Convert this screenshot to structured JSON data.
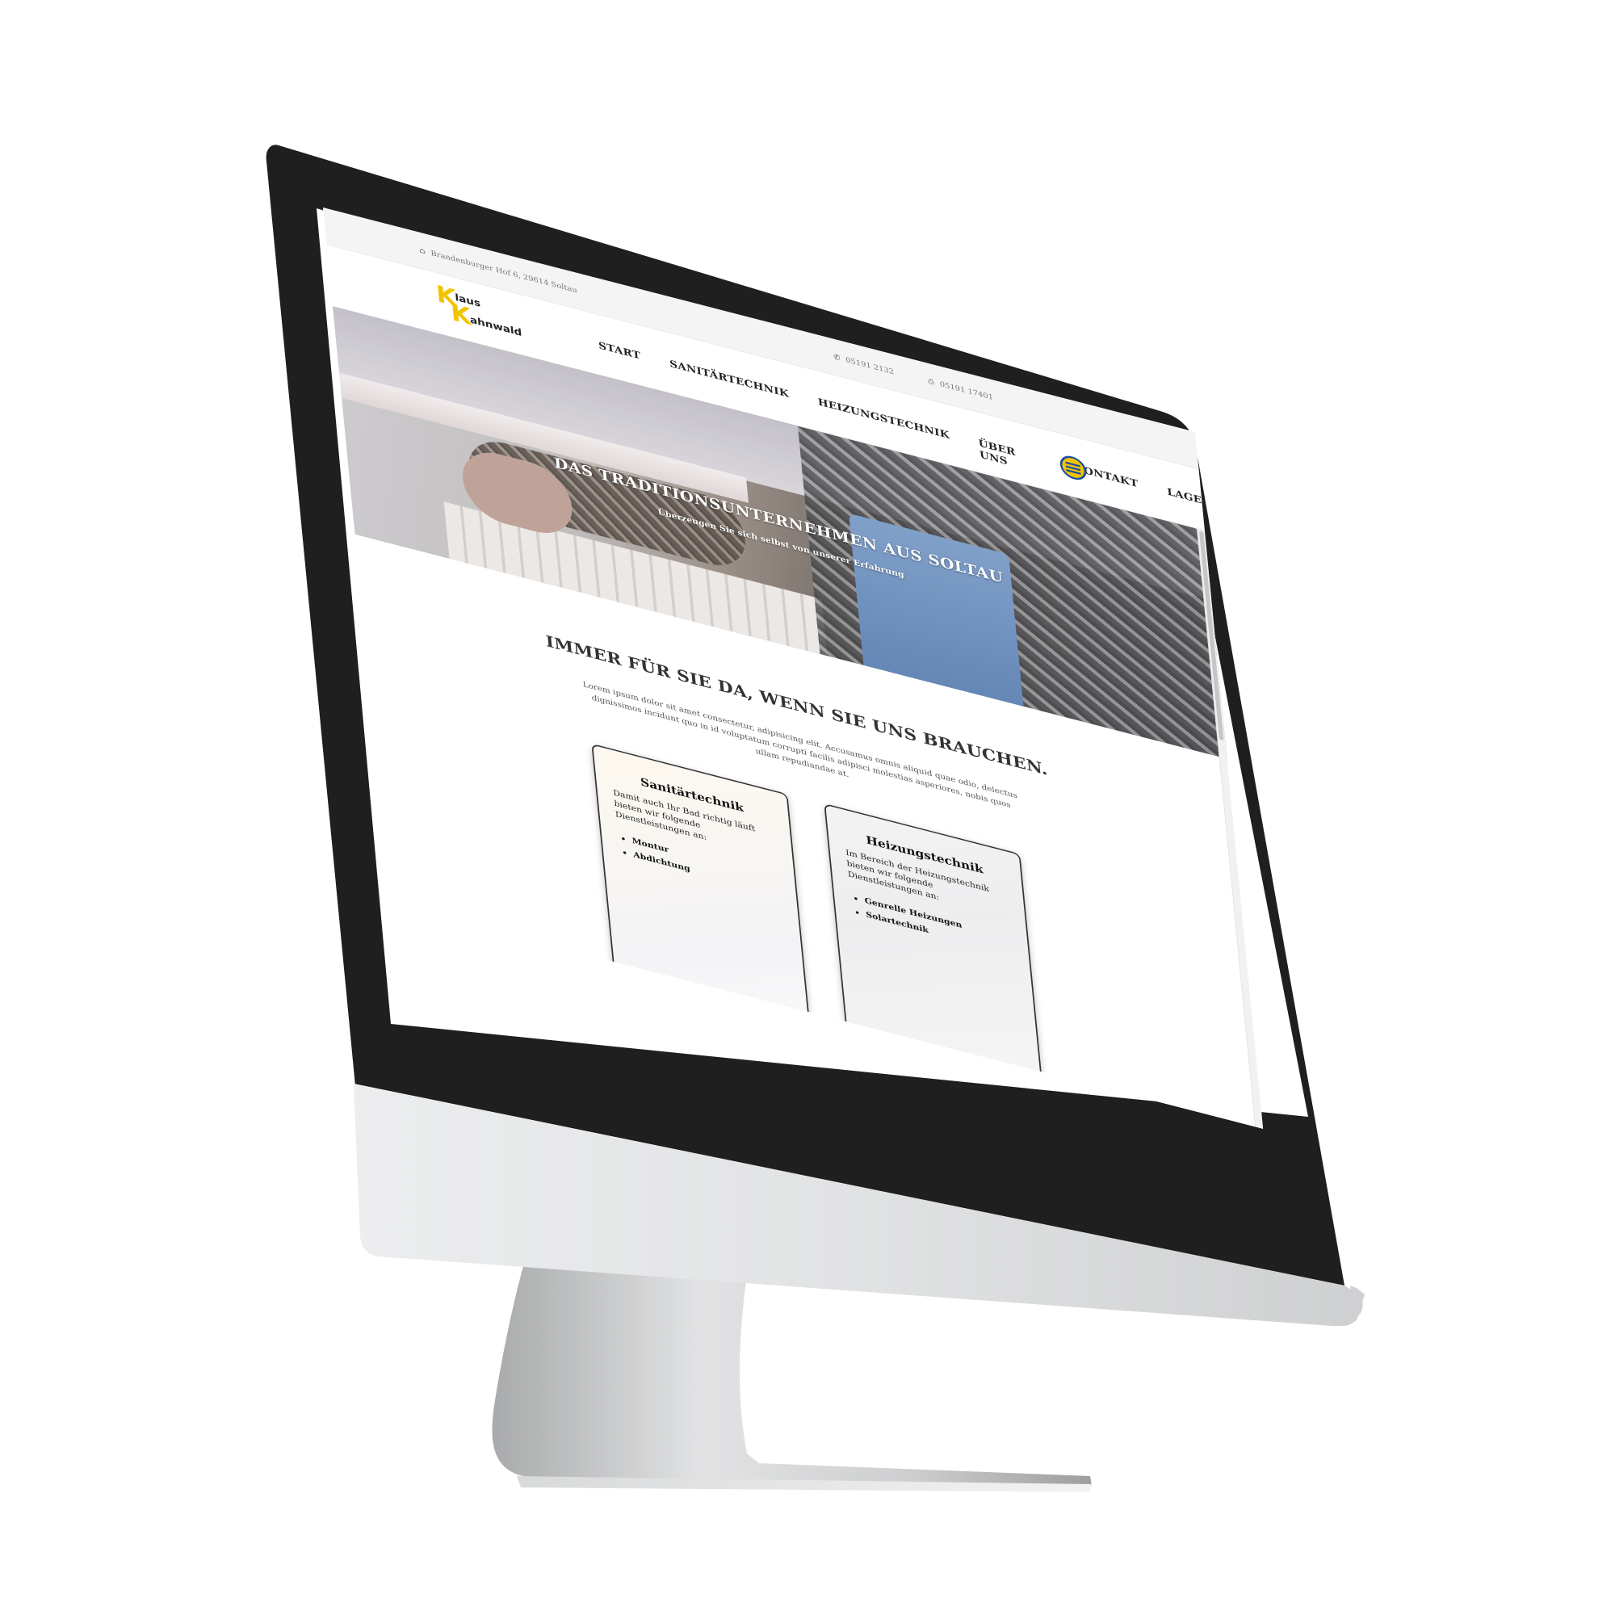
{
  "topbar": {
    "address": "Brandenburger Hof 6, 29614 Soltau",
    "phone": "05191 2132",
    "fax": "05191 17401"
  },
  "logo": {
    "letter_1": "K",
    "letter_2": "K",
    "word_1": "laus",
    "word_2": "ahnwald"
  },
  "nav": {
    "items": [
      {
        "label": "START"
      },
      {
        "label": "SANITÄRTECHNIK"
      },
      {
        "label": "HEIZUNGSTECHNIK"
      },
      {
        "label": "ÜBER UNS"
      },
      {
        "label": "KONTAKT"
      },
      {
        "label": "LAGE"
      }
    ]
  },
  "hero": {
    "title": "DAS TRADITIONSUNTERNEHMEN AUS SOLTAU",
    "subtitle": "Überzeugen Sie sich selbst von unserer Erfahrung"
  },
  "intro": {
    "heading": "IMMER FÜR SIE DA, WENN SIE UNS BRAUCHEN.",
    "text": "Lorem ipsum dolor sit amet consectetur, adipisicing elit. Accusamus omnis aliquid quae odio, delectus dignissimos incidunt quo in id voluptatum corrupti facilis adipisci molestias asperiores, nobis quos ullam repudiandae at."
  },
  "cards": [
    {
      "title": "Sanitärtechnik",
      "text": "Damit auch Ihr Bad richtig läuft bieten wir folgende Dienstleistungen an:",
      "items": [
        "Montur",
        "Abdichtung"
      ]
    },
    {
      "title": "Heizungstechnik",
      "text": "Im Bereich der Heizungstechnik bieten wir folgende Dienstleistungen an:",
      "items": [
        "Genrelle Heizungen",
        "Solartechnik"
      ]
    }
  ],
  "colors": {
    "accent": "#f2c400",
    "badge_blue": "#1e4fa0",
    "device_bezel": "#1f1f1f",
    "device_silver": "#d9dadb"
  },
  "icons": {
    "address": "home-icon",
    "phone": "phone-icon",
    "fax": "print-icon",
    "badge": "handwerk-badge-icon"
  }
}
